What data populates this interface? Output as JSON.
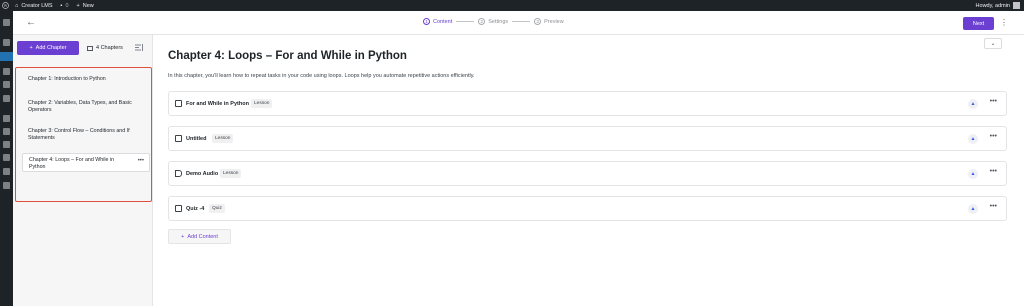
{
  "adminbar": {
    "site_name": "Creator LMS",
    "comments_count": "0",
    "new_label": "New",
    "greeting": "Howdy, admin"
  },
  "topbar": {
    "steps": [
      {
        "num": "1",
        "label": "Content"
      },
      {
        "num": "2",
        "label": "Settings"
      },
      {
        "num": "3",
        "label": "Preview"
      }
    ],
    "next_label": "Next"
  },
  "left_panel": {
    "add_chapter_label": "Add Chapter",
    "chapter_count": "4 Chapters",
    "chapters": [
      "Chapter 1: Introduction to Python",
      "Chapter 2: Variables, Data Types, and Basic Operators",
      "Chapter 3: Control Flow – Conditions and If Statements",
      "Chapter 4: Loops – For and While in Python"
    ]
  },
  "main": {
    "title": "Chapter 4: Loops – For and While in Python",
    "description": "In this chapter, you'll learn how to repeat tasks in your code using loops. Loops help you automate repetitive actions efficiently.",
    "items": [
      {
        "title": "For and While in Python",
        "badge": "Lesson",
        "icon": "book-icon"
      },
      {
        "title": "Untitled",
        "badge": "Lesson",
        "icon": "video-icon"
      },
      {
        "title": "Demo Audio",
        "badge": "Lesson",
        "icon": "audio-icon"
      },
      {
        "title": "Quiz -4",
        "badge": "Quiz",
        "icon": "quiz-icon"
      }
    ],
    "add_content_label": "Add Content"
  },
  "colors": {
    "accent": "#6b3fd1",
    "highlight": "#e0503e",
    "admin_bar": "#1d2327"
  }
}
